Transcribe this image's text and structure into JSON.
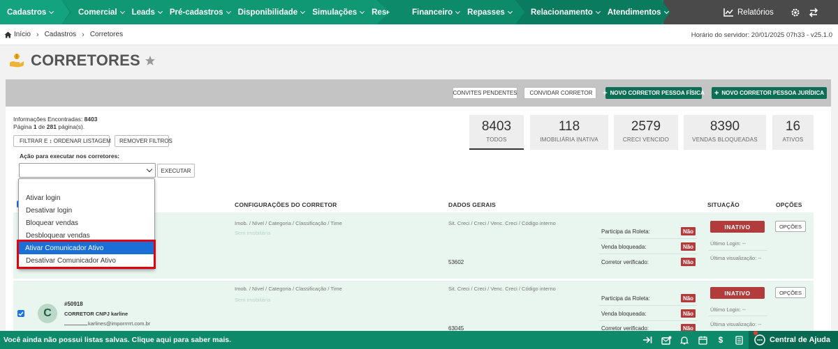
{
  "nav": {
    "items_a": [
      {
        "label": "Cadastros"
      }
    ],
    "items_b": [
      {
        "label": "Comercial"
      },
      {
        "label": "Leads"
      },
      {
        "label": "Pré-cadastros"
      },
      {
        "label": "Disponibilidade"
      },
      {
        "label": "Simulações"
      },
      {
        "label": "Reservas"
      }
    ],
    "items_c": [
      {
        "label": "Financeiro"
      },
      {
        "label": "Repasses"
      }
    ],
    "items_d": [
      {
        "label": "Relacionamento"
      },
      {
        "label": "Atendimentos"
      }
    ],
    "relatorios": "Relatórios"
  },
  "breadcrumb": [
    "Início",
    "Cadastros",
    "Corretores"
  ],
  "server_time": "Horário do servidor: 20/01/2025 07h33 - v25.1.0",
  "page_title": "CORRETORES",
  "actions": {
    "convites": "CONVITES PENDENTES",
    "convidar": "CONVIDAR CORRETOR",
    "novo_pf": "NOVO CORRETOR PESSOA FÍSICA",
    "novo_pj": "NOVO CORRETOR PESSOA JURÍDICA"
  },
  "info": {
    "found_label": "Informações Encontradas:",
    "found_count": "8403",
    "page_prefix": "Página",
    "page_current": "1",
    "page_mid": "de",
    "page_total": "281",
    "page_suffix": "página(s)."
  },
  "filters": {
    "filtrar": "FILTRAR E ↕ ORDENAR LISTAGEM",
    "remover": "REMOVER FILTROS"
  },
  "bulk": {
    "label": "Ação para executar nos corretores:",
    "execute": "EXECUTAR",
    "options": [
      "Ativar login",
      "Desativar login",
      "Bloquear vendas",
      "Desbloquear vendas",
      "Ativar Comunicador Ativo",
      "Desativar Comunicador Ativo"
    ],
    "selected": "Ativar Comunicador Ativo"
  },
  "stats": [
    {
      "num": "8403",
      "label": "TODOS"
    },
    {
      "num": "118",
      "label": "IMOBILIÁRIA INATIVA"
    },
    {
      "num": "2579",
      "label": "CRECI VENCIDO"
    },
    {
      "num": "8390",
      "label": "VENDAS BLOQUEADAS"
    },
    {
      "num": "16",
      "label": "ATIVOS"
    }
  ],
  "table": {
    "headers": [
      "CONFIGURAÇÕES DO CORRETOR",
      "DADOS GERAIS",
      "SITUAÇÃO",
      "OPÇÕES"
    ],
    "config_sub": "Imob. / Nível / Categoria / Classificação / Time",
    "config_faint": "Sem imobiliária",
    "dados_sub": "Sit. Creci / Creci / Venc. Creci / Código interno",
    "participa": "Participa da Roleta:",
    "venda": "Venda bloqueada:",
    "verificado": "Corretor verificado:",
    "nao": "Não",
    "inativo": "INATIVO",
    "opcoes": "OPÇÕES",
    "ultimo_login": "Último Login: --",
    "ultima_vis": "Última visualização: --",
    "rows": [
      {
        "code": "53602"
      },
      {
        "id": "#50918",
        "name": "CORRETOR CNPJ karline",
        "email": "karlines@imporrrrrt.com.br",
        "initial": "C",
        "code": "63045"
      }
    ]
  },
  "bottom": {
    "message": "Você ainda não possui listas salvas. Clique aqui para saber mais.",
    "help": "Central de Ajuda",
    "dollar": "$"
  },
  "colors": {
    "primary": "#0c8a6a",
    "dark_green": "#0c6e55",
    "danger": "#b23b3b",
    "highlight": "#1a6fd6"
  }
}
